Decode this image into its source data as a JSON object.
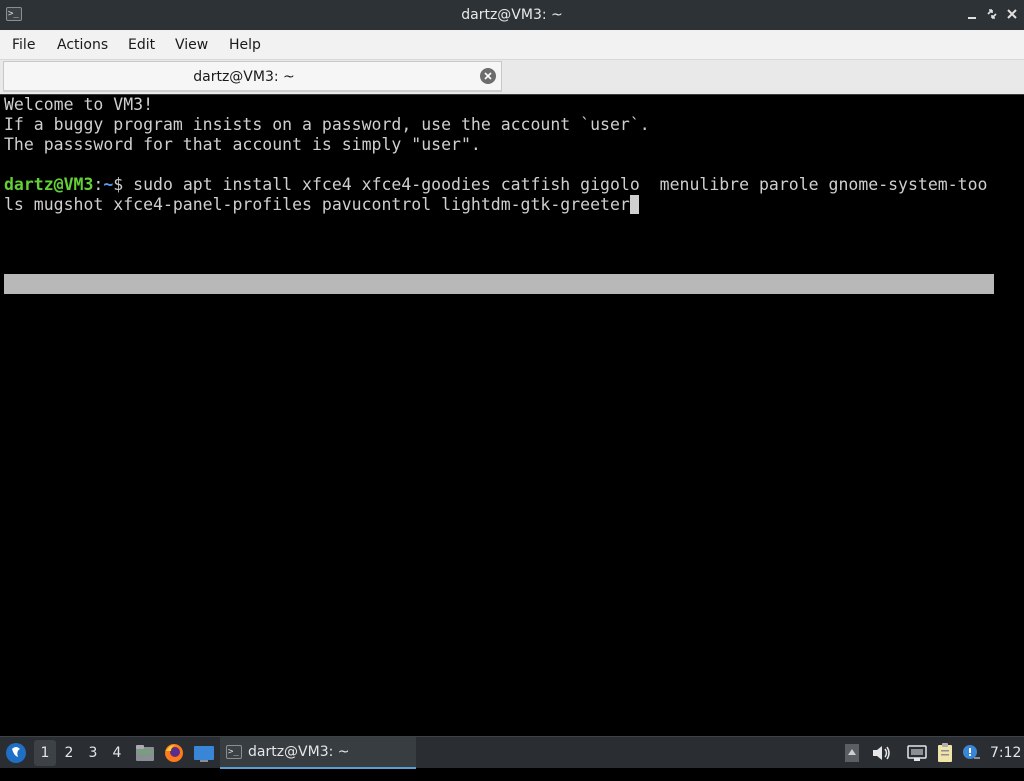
{
  "window": {
    "title": "dartz@VM3: ~",
    "app_icon": "terminal-icon",
    "app_icon_glyph": ">_"
  },
  "menu": {
    "items": [
      "File",
      "Actions",
      "Edit",
      "View",
      "Help"
    ]
  },
  "tab": {
    "label": "dartz@VM3: ~",
    "close_icon": "close-icon"
  },
  "terminal": {
    "lines": [
      "Welcome to VM3!",
      "If a buggy program insists on a password, use the account `user`.",
      "The passsword for that account is simply \"user\"."
    ],
    "prompt_user": "dartz@VM3",
    "prompt_sep": ":",
    "prompt_path": "~",
    "prompt_symbol": "$ ",
    "command_line1": "sudo apt install xfce4 xfce4-goodies catfish gigolo  menulibre parole gnome-system-too",
    "command_line2": "ls mugshot xfce4-panel-profiles pavucontrol lightdm-gtk-greeter"
  },
  "taskbar": {
    "workspaces": [
      "1",
      "2",
      "3",
      "4"
    ],
    "active_workspace": "1",
    "task_label": "dartz@VM3: ~",
    "clock": "7:12",
    "colors": {
      "panel_bg": "#2a2e32",
      "accent": "#5a9fd4"
    }
  },
  "colors": {
    "prompt_user": "#62d036",
    "prompt_path": "#5c9bf0",
    "terminal_bg": "#000000",
    "terminal_fg": "#cfcfcf"
  }
}
